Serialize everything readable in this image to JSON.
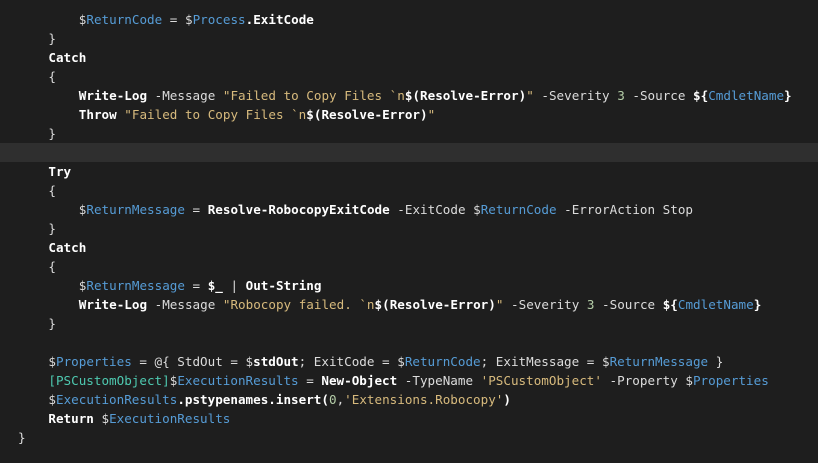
{
  "colors": {
    "background": "#1e1e1e",
    "current_line": "#2f2f2f",
    "default": "#dcdcdc",
    "variable": "#569cd6",
    "keyword": "#ffffff",
    "string": "#d7ba7d",
    "number": "#b5cea8",
    "type": "#4ec9b0",
    "operator": "#dcdcdc"
  },
  "lines": [
    {
      "indent": 10,
      "tokens": [
        {
          "t": "$",
          "c": "default"
        },
        {
          "t": "ReturnCode",
          "c": "variable"
        },
        {
          "t": " = ",
          "c": "operator"
        },
        {
          "t": "$",
          "c": "default"
        },
        {
          "t": "Process",
          "c": "variable"
        },
        {
          "t": ".ExitCode",
          "c": "keyword"
        }
      ]
    },
    {
      "indent": 6,
      "tokens": [
        {
          "t": "}",
          "c": "default"
        }
      ]
    },
    {
      "indent": 6,
      "tokens": [
        {
          "t": "Catch",
          "c": "keyword"
        }
      ]
    },
    {
      "indent": 6,
      "tokens": [
        {
          "t": "{",
          "c": "default"
        }
      ]
    },
    {
      "indent": 10,
      "tokens": [
        {
          "t": "Write-Log",
          "c": "keyword"
        },
        {
          "t": " -Message ",
          "c": "default"
        },
        {
          "t": "\"Failed to Copy Files `n",
          "c": "string"
        },
        {
          "t": "$(Resolve-Error)",
          "c": "keyword"
        },
        {
          "t": "\"",
          "c": "string"
        },
        {
          "t": " -Severity ",
          "c": "default"
        },
        {
          "t": "3",
          "c": "number"
        },
        {
          "t": " -Source ",
          "c": "default"
        },
        {
          "t": "${",
          "c": "keyword"
        },
        {
          "t": "CmdletName",
          "c": "variable"
        },
        {
          "t": "}",
          "c": "keyword"
        }
      ]
    },
    {
      "indent": 10,
      "tokens": [
        {
          "t": "Throw ",
          "c": "keyword"
        },
        {
          "t": "\"Failed to Copy Files `n",
          "c": "string"
        },
        {
          "t": "$(Resolve-Error)",
          "c": "keyword"
        },
        {
          "t": "\"",
          "c": "string"
        }
      ]
    },
    {
      "indent": 6,
      "tokens": [
        {
          "t": "}",
          "c": "default"
        }
      ]
    },
    {
      "indent": 0,
      "current": true,
      "tokens": []
    },
    {
      "indent": 6,
      "tokens": [
        {
          "t": "Try",
          "c": "keyword"
        }
      ]
    },
    {
      "indent": 6,
      "tokens": [
        {
          "t": "{",
          "c": "default"
        }
      ]
    },
    {
      "indent": 10,
      "tokens": [
        {
          "t": "$",
          "c": "default"
        },
        {
          "t": "ReturnMessage",
          "c": "variable"
        },
        {
          "t": " = ",
          "c": "operator"
        },
        {
          "t": "Resolve-RobocopyExitCode",
          "c": "keyword"
        },
        {
          "t": " -ExitCode ",
          "c": "default"
        },
        {
          "t": "$",
          "c": "default"
        },
        {
          "t": "ReturnCode",
          "c": "variable"
        },
        {
          "t": " -ErrorAction Stop",
          "c": "default"
        }
      ]
    },
    {
      "indent": 6,
      "tokens": [
        {
          "t": "}",
          "c": "default"
        }
      ]
    },
    {
      "indent": 6,
      "tokens": [
        {
          "t": "Catch",
          "c": "keyword"
        }
      ]
    },
    {
      "indent": 6,
      "tokens": [
        {
          "t": "{",
          "c": "default"
        }
      ]
    },
    {
      "indent": 10,
      "tokens": [
        {
          "t": "$",
          "c": "default"
        },
        {
          "t": "ReturnMessage",
          "c": "variable"
        },
        {
          "t": " = ",
          "c": "operator"
        },
        {
          "t": "$_",
          "c": "keyword"
        },
        {
          "t": " | ",
          "c": "default"
        },
        {
          "t": "Out-String",
          "c": "keyword"
        }
      ]
    },
    {
      "indent": 10,
      "tokens": [
        {
          "t": "Write-Log",
          "c": "keyword"
        },
        {
          "t": " -Message ",
          "c": "default"
        },
        {
          "t": "\"Robocopy failed. `n",
          "c": "string"
        },
        {
          "t": "$(Resolve-Error)",
          "c": "keyword"
        },
        {
          "t": "\"",
          "c": "string"
        },
        {
          "t": " -Severity ",
          "c": "default"
        },
        {
          "t": "3",
          "c": "number"
        },
        {
          "t": " -Source ",
          "c": "default"
        },
        {
          "t": "${",
          "c": "keyword"
        },
        {
          "t": "CmdletName",
          "c": "variable"
        },
        {
          "t": "}",
          "c": "keyword"
        }
      ]
    },
    {
      "indent": 6,
      "tokens": [
        {
          "t": "}",
          "c": "default"
        }
      ]
    },
    {
      "indent": 0,
      "tokens": []
    },
    {
      "indent": 6,
      "tokens": [
        {
          "t": "$",
          "c": "default"
        },
        {
          "t": "Properties",
          "c": "variable"
        },
        {
          "t": " = @{ StdOut = ",
          "c": "default"
        },
        {
          "t": "$",
          "c": "default"
        },
        {
          "t": "stdOut",
          "c": "keyword"
        },
        {
          "t": "; ExitCode = ",
          "c": "default"
        },
        {
          "t": "$",
          "c": "default"
        },
        {
          "t": "ReturnCode",
          "c": "variable"
        },
        {
          "t": "; ExitMessage = ",
          "c": "default"
        },
        {
          "t": "$",
          "c": "default"
        },
        {
          "t": "ReturnMessage",
          "c": "variable"
        },
        {
          "t": " }",
          "c": "default"
        }
      ]
    },
    {
      "indent": 6,
      "tokens": [
        {
          "t": "[PSCustomObject]",
          "c": "type"
        },
        {
          "t": "$",
          "c": "default"
        },
        {
          "t": "ExecutionResults",
          "c": "variable"
        },
        {
          "t": " = ",
          "c": "operator"
        },
        {
          "t": "New-Object",
          "c": "keyword"
        },
        {
          "t": " -TypeName ",
          "c": "default"
        },
        {
          "t": "'PSCustomObject'",
          "c": "string"
        },
        {
          "t": " -Property ",
          "c": "default"
        },
        {
          "t": "$",
          "c": "default"
        },
        {
          "t": "Properties",
          "c": "variable"
        }
      ]
    },
    {
      "indent": 6,
      "tokens": [
        {
          "t": "$",
          "c": "default"
        },
        {
          "t": "ExecutionResults",
          "c": "variable"
        },
        {
          "t": ".pstypenames.insert(",
          "c": "keyword"
        },
        {
          "t": "0",
          "c": "number"
        },
        {
          "t": ",",
          "c": "default"
        },
        {
          "t": "'Extensions.Robocopy'",
          "c": "string"
        },
        {
          "t": ")",
          "c": "keyword"
        }
      ]
    },
    {
      "indent": 6,
      "tokens": [
        {
          "t": "Return ",
          "c": "keyword"
        },
        {
          "t": "$",
          "c": "default"
        },
        {
          "t": "ExecutionResults",
          "c": "variable"
        }
      ]
    },
    {
      "indent": 2,
      "tokens": [
        {
          "t": "}",
          "c": "default"
        }
      ]
    }
  ]
}
